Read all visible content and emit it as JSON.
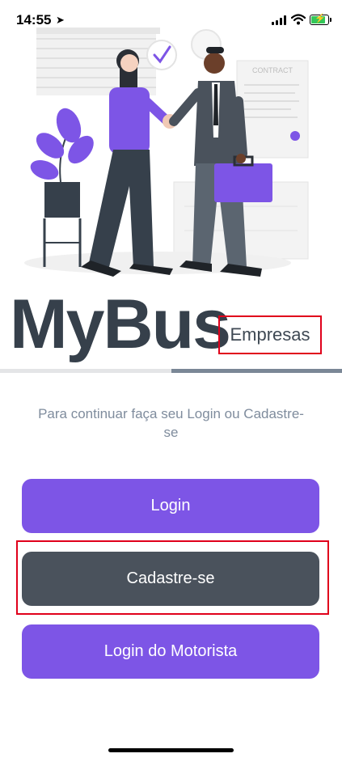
{
  "status_bar": {
    "time": "14:55",
    "battery_charging": true
  },
  "brand": {
    "name": "MyBus",
    "suffix": "Empresas"
  },
  "illustration": {
    "contract_label": "CONTRACT"
  },
  "subtitle": "Para continuar faça seu Login ou Cadastre-se",
  "progress": {
    "value": 0.5
  },
  "buttons": {
    "login": "Login",
    "signup": "Cadastre-se",
    "driver_login": "Login do Motorista"
  },
  "colors": {
    "primary": "#7d55e6",
    "secondary": "#4a525c",
    "brand_text": "#36404b",
    "subtitle": "#7f8c9d",
    "highlight": "#e0001b"
  }
}
